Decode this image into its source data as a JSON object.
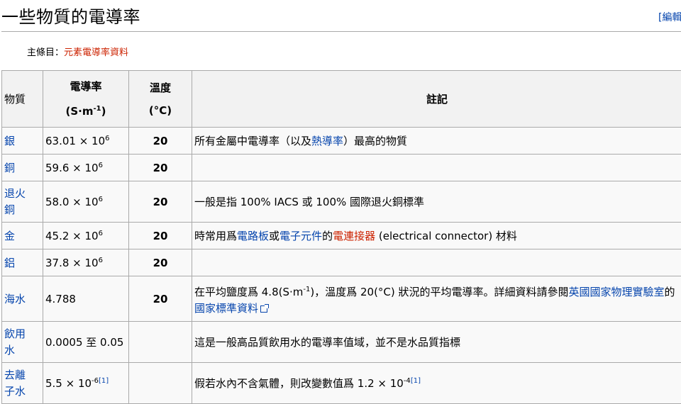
{
  "section": {
    "title": "一些物質的電導率",
    "edit_label": "[編輯]"
  },
  "main_article": {
    "prefix": "主條目：",
    "link": "元素電導率資料"
  },
  "table": {
    "headers": {
      "substance": "物質",
      "conductivity": "電導率",
      "conductivity_unit_pre": "(S·m",
      "conductivity_unit_sup": "-1",
      "conductivity_unit_post": ")",
      "temperature": "溫度",
      "temperature_unit": "(°C)",
      "notes": "註記"
    },
    "rows": [
      {
        "substance": "銀",
        "value": "63.01 × 10",
        "exp": "6",
        "temp": "20",
        "note_a": "所有金屬中電導率（以及",
        "note_link": "熱導率",
        "note_b": "）最高的物質"
      },
      {
        "substance": "銅",
        "value": "59.6 × 10",
        "exp": "6",
        "temp": "20"
      },
      {
        "substance_1": "退火",
        "substance_2": "銅",
        "value": "58.0 × 10",
        "exp": "6",
        "temp": "20",
        "note": "一般是指 100% IACS 或 100% 國際退火銅標準"
      },
      {
        "substance": "金",
        "value": "45.2 × 10",
        "exp": "6",
        "temp": "20",
        "note_link1": "電路板",
        "note_t1": "或",
        "note_link2": "電子元件",
        "note_t2": "的",
        "note_link3": "電連接器",
        "note_t3": " (electrical connector) 材料",
        "note_pre": "時常用爲"
      },
      {
        "substance": "鋁",
        "value": "37.8 × 10",
        "exp": "6",
        "temp": "20"
      },
      {
        "substance": "海水",
        "value": "4.788",
        "temp": "20",
        "note_a": "在平均鹽度爲 4.8(S·m",
        "note_sup": "-1",
        "note_b": ")，溫度爲 20(°C) 狀況的平均電導率。詳細資料請參閱",
        "note_link1": "英國國家物理實驗室",
        "note_c": "的 ",
        "note_link2": "國家標準資料"
      },
      {
        "substance_1": "飲用",
        "substance_2": "水",
        "value": "0.0005 至 0.05",
        "note": "這是一般高品質飲用水的電導率值域，並不是水品質指標"
      },
      {
        "substance_1": "去離",
        "substance_2": "子水",
        "value": "5.5 × 10",
        "exp": "-6",
        "ref": "[1]",
        "note_a": "假若水內不含氣體，則改變數值爲 1.2 × 10",
        "note_sup": "-4",
        "note_ref": "[1]"
      }
    ]
  }
}
